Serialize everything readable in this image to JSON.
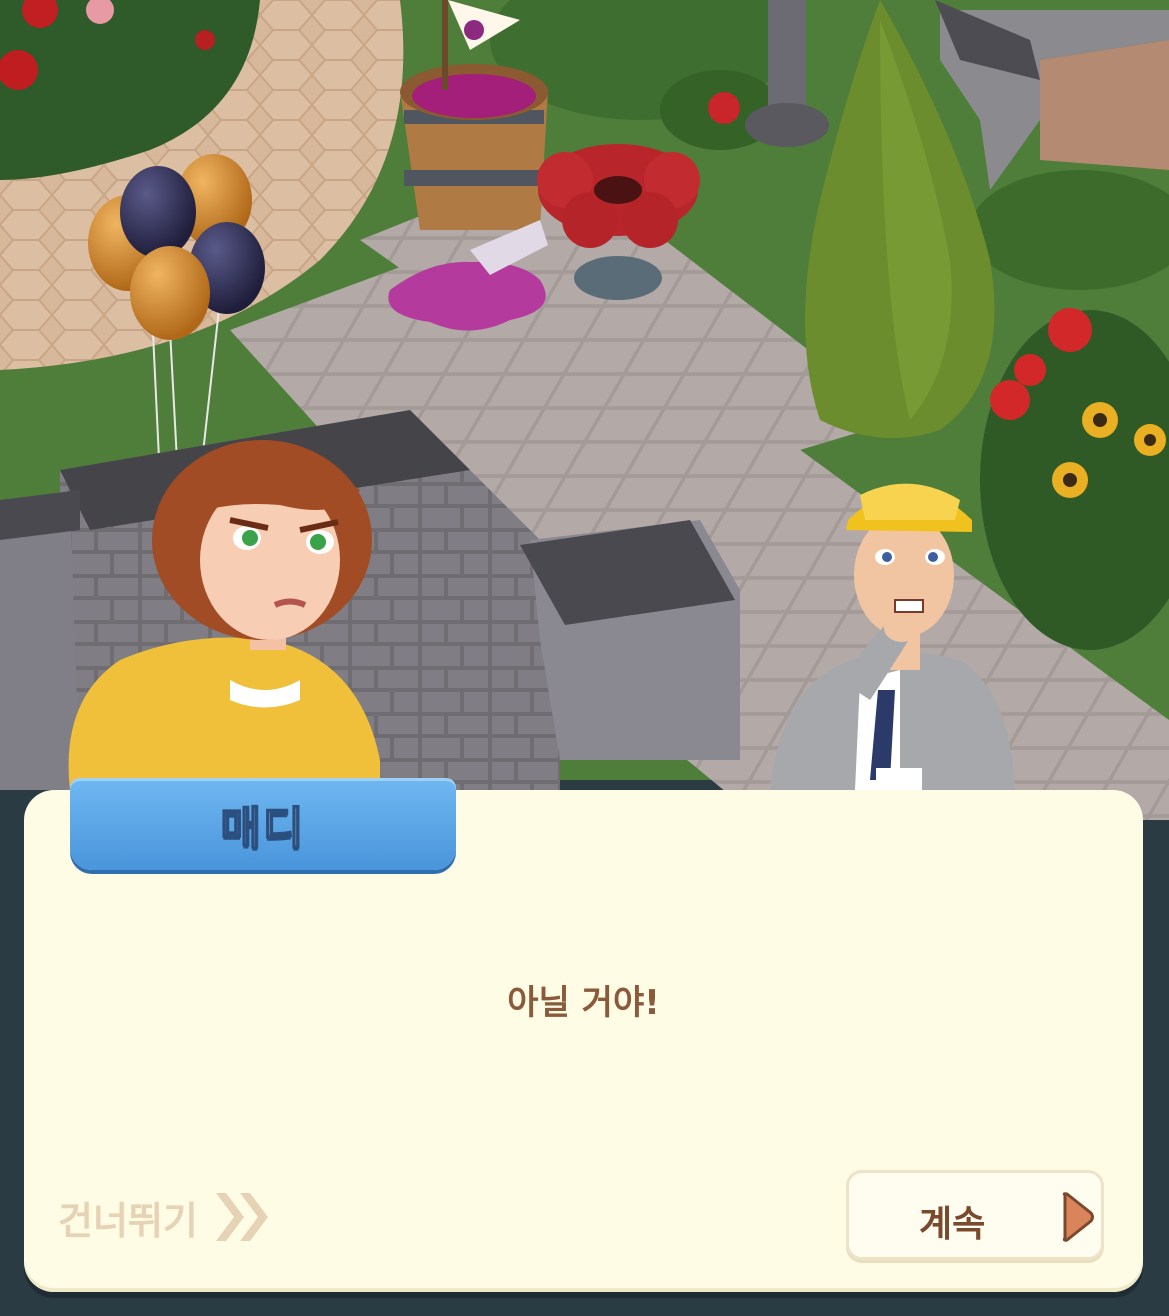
{
  "dialog": {
    "speaker": "매디",
    "message": "아닐 거야!",
    "skip_label": "건너뛰기",
    "continue_label": "계속"
  },
  "characters": [
    {
      "name": "매디",
      "position": "left"
    },
    {
      "name": "construction-foreman",
      "position": "right"
    }
  ],
  "colors": {
    "dialog_bg": "#fffce6",
    "name_tab": "#5aa6e6",
    "message_text": "#8a5a3a",
    "skip_text": "#e6d3b6",
    "continue_text": "#7a4a2e",
    "arrow_fill": "#d9845a"
  }
}
